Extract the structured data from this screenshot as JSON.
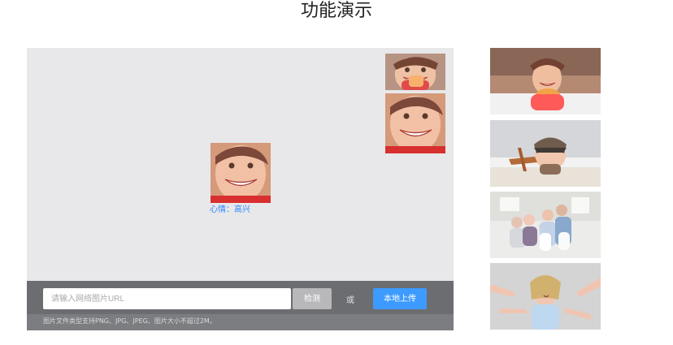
{
  "header": {
    "title": "功能演示"
  },
  "demo": {
    "emotion_text": "心情：高兴",
    "url_placeholder": "请输入网络图片URL",
    "detect_button_label": "检测",
    "or_text": "或",
    "upload_button_label": "本地上传",
    "hint_text": "图片文件类型支持PNG、JPG、JPEG、图片大小不超过2M。"
  },
  "colors": {
    "accent": "#3d9bff",
    "emotion_text": "#2e86ff",
    "panel_background": "#e8e8ea",
    "bottom_bar": "#6c6d70"
  },
  "gallery": {
    "items": [
      {
        "icon": "girl-eating-candy-photo"
      },
      {
        "icon": "boy-with-toy-plane-photo"
      },
      {
        "icon": "family-portrait-photo"
      },
      {
        "icon": "stressed-woman-photo"
      }
    ]
  }
}
